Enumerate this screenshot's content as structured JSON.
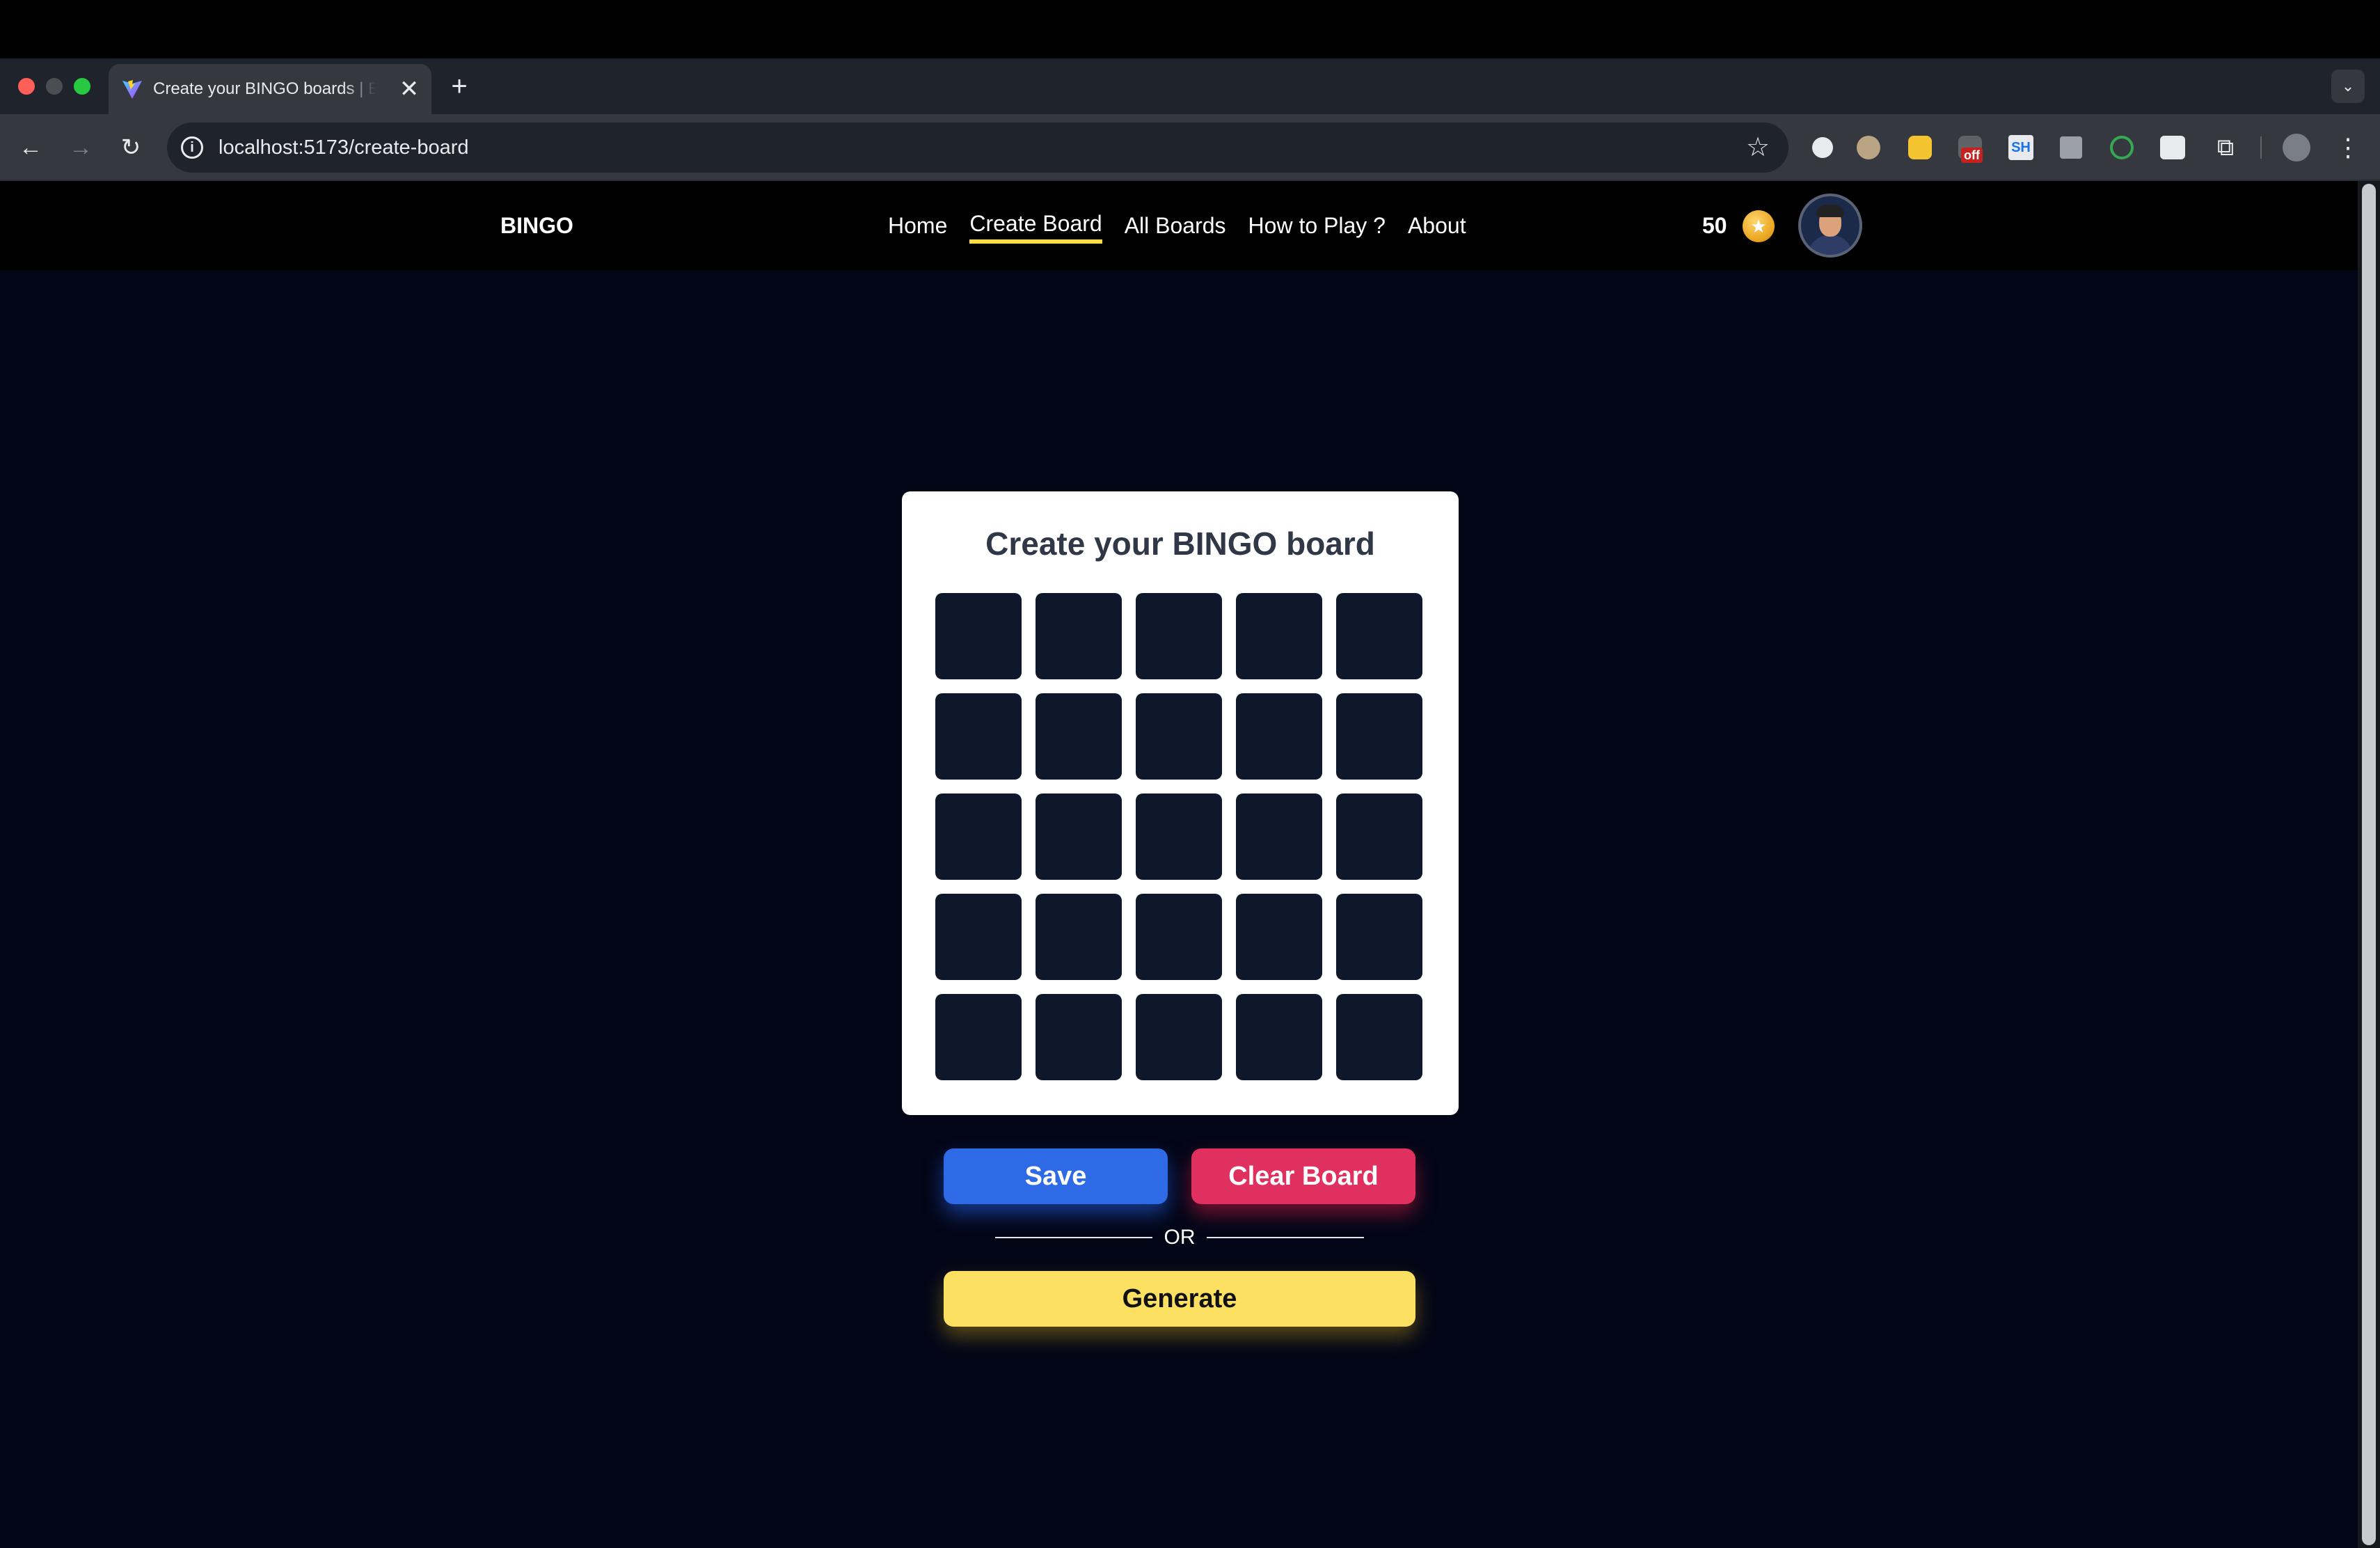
{
  "browser": {
    "tab_title": "Create your BINGO boards | BINGO",
    "tab_close": "✕",
    "new_tab": "+",
    "tab_dropdown": "⌄",
    "back": "←",
    "forward": "→",
    "reload": "↻",
    "info_icon": "i",
    "url": "localhost:5173/create-board",
    "bookmark_star": "☆",
    "extension_badge": "off",
    "extension_sh": "SH",
    "extensions_icon": "⧉",
    "menu": "⋮"
  },
  "site": {
    "logo": "BINGO",
    "nav": [
      {
        "label": "Home",
        "active": false
      },
      {
        "label": "Create Board",
        "active": true
      },
      {
        "label": "All Boards",
        "active": false
      },
      {
        "label": "How to Play ?",
        "active": false
      },
      {
        "label": "About",
        "active": false
      }
    ],
    "coins": "50",
    "coin_icon": "★"
  },
  "board": {
    "title": "Create your BINGO board",
    "rows": 5,
    "cols": 5,
    "cells": [
      "",
      "",
      "",
      "",
      "",
      "",
      "",
      "",
      "",
      "",
      "",
      "",
      "",
      "",
      "",
      "",
      "",
      "",
      "",
      "",
      "",
      "",
      "",
      "",
      ""
    ]
  },
  "actions": {
    "save": "Save",
    "clear": "Clear Board",
    "or": "OR",
    "generate": "Generate"
  },
  "colors": {
    "page_bg": "#030617",
    "cell_bg": "#0f172a",
    "save": "#2f6ae6",
    "clear": "#e0305f",
    "generate": "#fbe061",
    "active_underline": "#fde047"
  }
}
